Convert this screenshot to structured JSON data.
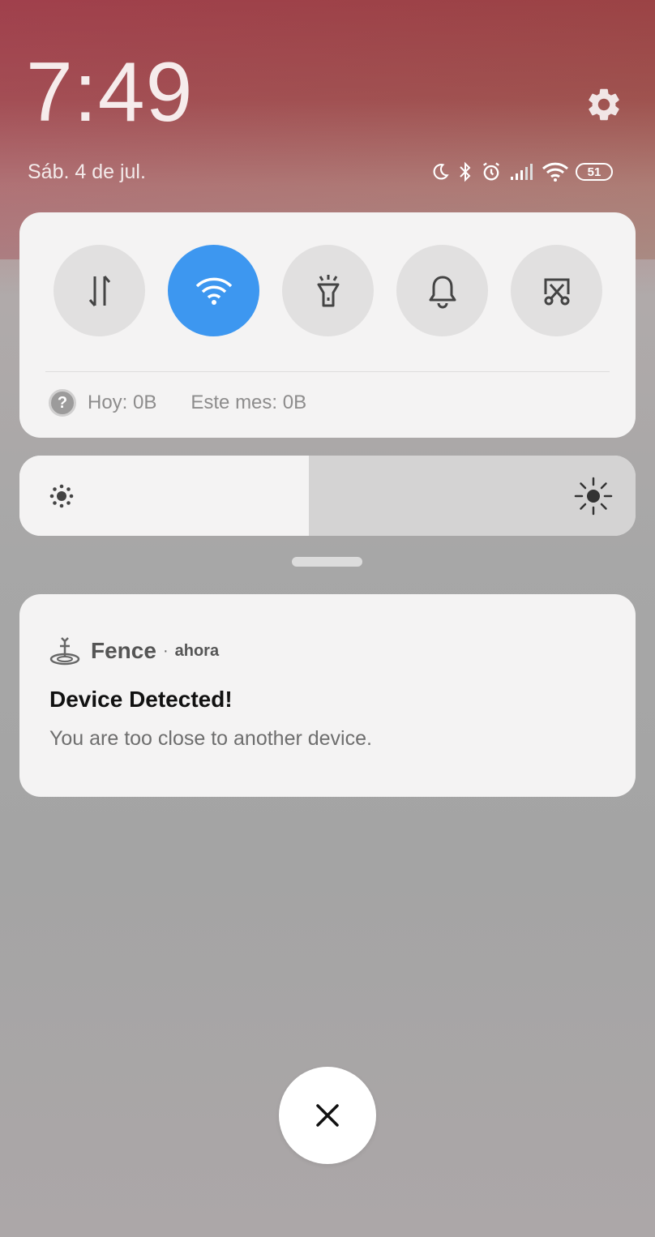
{
  "lockscreen": {
    "time": "7:49",
    "date": "Sáb. 4 de jul.",
    "battery_level": "51"
  },
  "status_icons": [
    "moon-icon",
    "bluetooth-icon",
    "alarm-icon",
    "signal-icon",
    "wifi-icon",
    "battery-icon"
  ],
  "quick_settings": {
    "tiles": [
      {
        "name": "mobile-data",
        "icon": "data-transfer-icon",
        "active": false
      },
      {
        "name": "wifi",
        "icon": "wifi-icon",
        "active": true
      },
      {
        "name": "flashlight",
        "icon": "flashlight-icon",
        "active": false
      },
      {
        "name": "sound",
        "icon": "bell-icon",
        "active": false
      },
      {
        "name": "screenshot",
        "icon": "scissors-screenshot-icon",
        "active": false
      }
    ],
    "usage_today": "Hoy: 0B",
    "usage_month": "Este mes: 0B",
    "accent_color": "#3d97f0"
  },
  "brightness": {
    "level": 0.47
  },
  "notification": {
    "app_name": "Fence",
    "separator": "·",
    "time": "ahora",
    "title": "Device Detected!",
    "body": "You are too close to another device."
  }
}
